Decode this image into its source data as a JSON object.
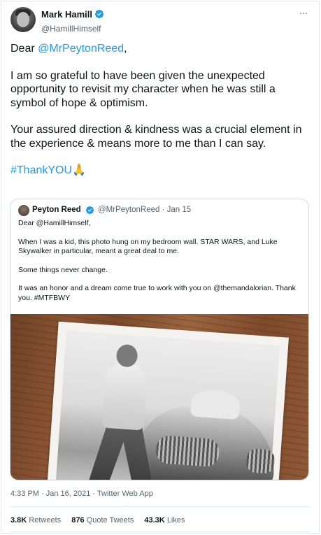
{
  "author": {
    "display_name": "Mark Hamill",
    "handle": "@HamillHimself",
    "more_icon": "⋯"
  },
  "tweet": {
    "salutation_prefix": "Dear ",
    "salutation_mention": "@MrPeytonReed",
    "salutation_suffix": ",",
    "paragraph_1": "I am so grateful to have been given the unexpected opportunity to revisit my character when he was still a symbol of hope & optimism.",
    "paragraph_2": "Your assured direction & kindness was a crucial element in the experience & means more to me than I can say.",
    "hashtag": "#ThankYOU",
    "emoji": "🙏"
  },
  "quote": {
    "display_name": "Peyton Reed",
    "handle_and_date": "@MrPeytonReed · Jan 15",
    "line_1": "Dear @HamillHimself,",
    "line_2": "When I was a kid, this photo hung on my bedroom wall. STAR WARS, and Luke Skywalker in particular, meant a great deal to me.",
    "line_3": "Some things never change.",
    "line_4": "It was an honor and a dream come true to work with you on @themandalorian. Thank you. #MTFBWY"
  },
  "meta": {
    "timestamp": "4:33 PM · Jan 16, 2021 · Twitter Web App"
  },
  "stats": {
    "retweets_count": "3.8K",
    "retweets_label": "Retweets",
    "quotes_count": "876",
    "quotes_label": "Quote Tweets",
    "likes_count": "43.3K",
    "likes_label": "Likes"
  },
  "colors": {
    "link": "#1d9bf0",
    "verified": "#1d9bf0",
    "text": "#0f1419",
    "secondary": "#536471"
  }
}
